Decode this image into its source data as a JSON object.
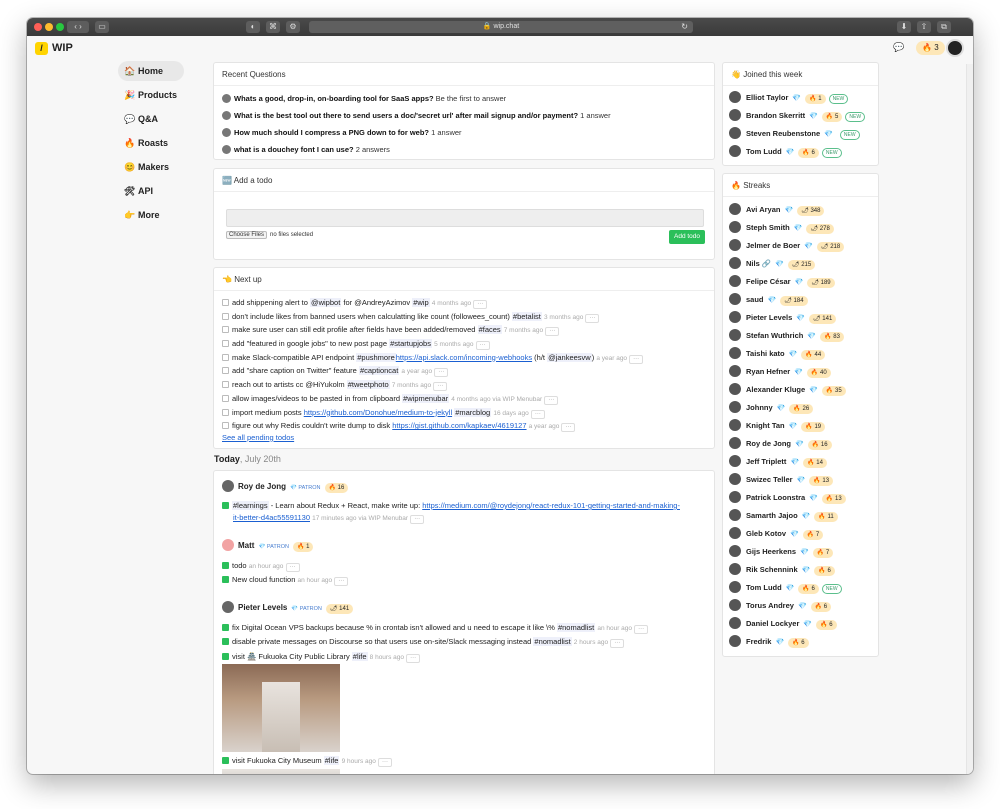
{
  "browser": {
    "url": "wip.chat"
  },
  "brand": {
    "name": "WIP",
    "streak": "3"
  },
  "sidebar": [
    {
      "icon": "🏠",
      "label": "Home"
    },
    {
      "icon": "🎉",
      "label": "Products"
    },
    {
      "icon": "💬",
      "label": "Q&A"
    },
    {
      "icon": "🔥",
      "label": "Roasts"
    },
    {
      "icon": "😊",
      "label": "Makers"
    },
    {
      "icon": "🛠",
      "label": "API"
    },
    {
      "icon": "👉",
      "label": "More"
    }
  ],
  "questions": {
    "title": "Recent Questions",
    "items": [
      {
        "q": "Whats a good, drop-in, on-boarding tool for SaaS apps?",
        "meta": "Be the first to answer"
      },
      {
        "q": "What is the best tool out there to send users a doc/'secret url' after mail signup and/or payment?",
        "meta": "1 answer"
      },
      {
        "q": "How much should I compress a PNG down to for web?",
        "meta": "1 answer"
      },
      {
        "q": "what is a douchey font I can use?",
        "meta": "2 answers"
      }
    ]
  },
  "add_todo": {
    "title": "Add a todo",
    "choose": "Choose Files",
    "no_files": "no files selected",
    "button": "Add todo"
  },
  "next_up": {
    "title": "Next up",
    "items": [
      {
        "pre": "add shippening alert to ",
        "tag": "@wipbot",
        "post": " for @AndreyAzimov ",
        "tag2": "#wip",
        "ago": "4 months ago"
      },
      {
        "pre": "don't include likes from banned users when calculatting like count (followees_count) ",
        "tag": "#betalist",
        "post": "",
        "tag2": "",
        "ago": "3 months ago"
      },
      {
        "pre": "make sure user can still edit profile after fields have been added/removed ",
        "tag": "#faces",
        "post": "",
        "tag2": "",
        "ago": "7 months ago"
      },
      {
        "pre": "add \"featured in google jobs\" to new post page ",
        "tag": "#startupjobs",
        "post": "",
        "tag2": "",
        "ago": "5 months ago"
      },
      {
        "pre": "make Slack-compatible API endpoint ",
        "tag": "#pushmore",
        "link": "https://api.slack.com/incoming-webhooks",
        "post": " (h/t ",
        "tag2": "@jankeesvw",
        "post2": ")",
        "ago": "a year ago"
      },
      {
        "pre": "add \"share caption on Twitter\" feature ",
        "tag": "#captioncat",
        "post": "",
        "tag2": "",
        "ago": "a year ago"
      },
      {
        "pre": "reach out to artists cc @HiYukolm ",
        "tag": "#tweetphoto",
        "post": "",
        "tag2": "",
        "ago": "7 months ago"
      },
      {
        "pre": "allow images/videos to be pasted in from clipboard ",
        "tag": "#wipmenubar",
        "post": "",
        "tag2": "",
        "ago": "4 months ago via WIP Menubar"
      },
      {
        "pre": "import medium posts ",
        "tag": "",
        "link": "https://github.com/Donohue/medium-to-jekyll",
        "post": " ",
        "tag2": "#marcblog",
        "ago": "16 days ago"
      },
      {
        "pre": "figure out why Redis couldn't write dump to disk ",
        "tag": "",
        "link": "https://gist.github.com/kapkaev/4619127",
        "post": "",
        "tag2": "",
        "ago": "a year ago"
      }
    ],
    "see_all": "See all pending todos"
  },
  "today": {
    "label": "Today",
    "date": ", July 20th"
  },
  "feed": {
    "roy": {
      "name": "Roy de Jong",
      "patron": "PATRON",
      "streak": "🔥 16",
      "tag": "#learnings",
      "text": " - Learn about Redux + React, make write up: ",
      "link1": "https://medium.com/@roydejong/react-redux-101-getting-started-and-making-",
      "link2": "it-better-d4ac55591130",
      "ago": "17 minutes ago via WIP Menubar"
    },
    "matt": {
      "name": "Matt",
      "patron": "PATRON",
      "streak": "🔥 1",
      "todo1": "todo",
      "ago1": "an hour ago",
      "todo2": "New cloud function",
      "ago2": "an hour ago"
    },
    "pieter": {
      "name": "Pieter Levels",
      "patron": "PATRON",
      "streak": "🌶 141",
      "t1": "fix Digital Ocean VPS backups because % in crontab isn't allowed and u need to escape it like \\% ",
      "t1tag": "#nomadlist",
      "t1ago": "an hour ago",
      "t2": "disable private messages on Discourse so that users use on-site/Slack messaging instead ",
      "t2tag": "#nomadlist",
      "t2ago": "2 hours ago",
      "t3": "visit 🏯 Fukuoka City Public Library ",
      "t3tag": "#life",
      "t3ago": "8 hours ago",
      "t4": "visit Fukuoka City Museum ",
      "t4tag": "#life",
      "t4ago": "9 hours ago"
    }
  },
  "joined": {
    "title": "Joined this week",
    "items": [
      {
        "name": "Elliot Taylor",
        "streak": "🔥 1",
        "new": "NEW"
      },
      {
        "name": "Brandon Skerritt",
        "streak": "🔥 5",
        "new": "NEW"
      },
      {
        "name": "Steven Reubenstone",
        "streak": "",
        "new": "NEW"
      },
      {
        "name": "Tom Ludd",
        "streak": "🔥 6",
        "new": "NEW"
      }
    ]
  },
  "streaks": {
    "title": "Streaks",
    "items": [
      {
        "name": "Avi Aryan",
        "streak": "🌶 348",
        "new": ""
      },
      {
        "name": "Steph Smith",
        "streak": "🌶 278",
        "new": ""
      },
      {
        "name": "Jelmer de Boer",
        "streak": "🌶 218",
        "new": ""
      },
      {
        "name": "Nils 🔗",
        "streak": "🌶 215",
        "new": ""
      },
      {
        "name": "Felipe César",
        "streak": "🌶 189",
        "new": ""
      },
      {
        "name": "saud",
        "streak": "🌶 184",
        "new": ""
      },
      {
        "name": "Pieter Levels",
        "streak": "🌶 141",
        "new": ""
      },
      {
        "name": "Stefan Wuthrich",
        "streak": "🔥 83",
        "new": ""
      },
      {
        "name": "Taishi kato",
        "streak": "🔥 44",
        "new": ""
      },
      {
        "name": "Ryan Hefner",
        "streak": "🔥 40",
        "new": ""
      },
      {
        "name": "Alexander Kluge",
        "streak": "🔥 35",
        "new": ""
      },
      {
        "name": "Johnny",
        "streak": "🔥 26",
        "new": ""
      },
      {
        "name": "Knight Tan",
        "streak": "🔥 19",
        "new": ""
      },
      {
        "name": "Roy de Jong",
        "streak": "🔥 16",
        "new": ""
      },
      {
        "name": "Jeff Triplett",
        "streak": "🔥 14",
        "new": ""
      },
      {
        "name": "Swizec Teller",
        "streak": "🔥 13",
        "new": ""
      },
      {
        "name": "Patrick Loonstra",
        "streak": "🔥 13",
        "new": ""
      },
      {
        "name": "Samarth Jajoo",
        "streak": "🔥 11",
        "new": ""
      },
      {
        "name": "Gleb Kotov",
        "streak": "🔥 7",
        "new": ""
      },
      {
        "name": "Gijs Heerkens",
        "streak": "🔥 7",
        "new": ""
      },
      {
        "name": "Rik Schennink",
        "streak": "🔥 6",
        "new": ""
      },
      {
        "name": "Tom Ludd",
        "streak": "🔥 6",
        "new": "NEW"
      },
      {
        "name": "Torus Andrey",
        "streak": "🔥 6",
        "new": ""
      },
      {
        "name": "Daniel Lockyer",
        "streak": "🔥 6",
        "new": ""
      },
      {
        "name": "Fredrik",
        "streak": "🔥 6",
        "new": ""
      }
    ]
  }
}
